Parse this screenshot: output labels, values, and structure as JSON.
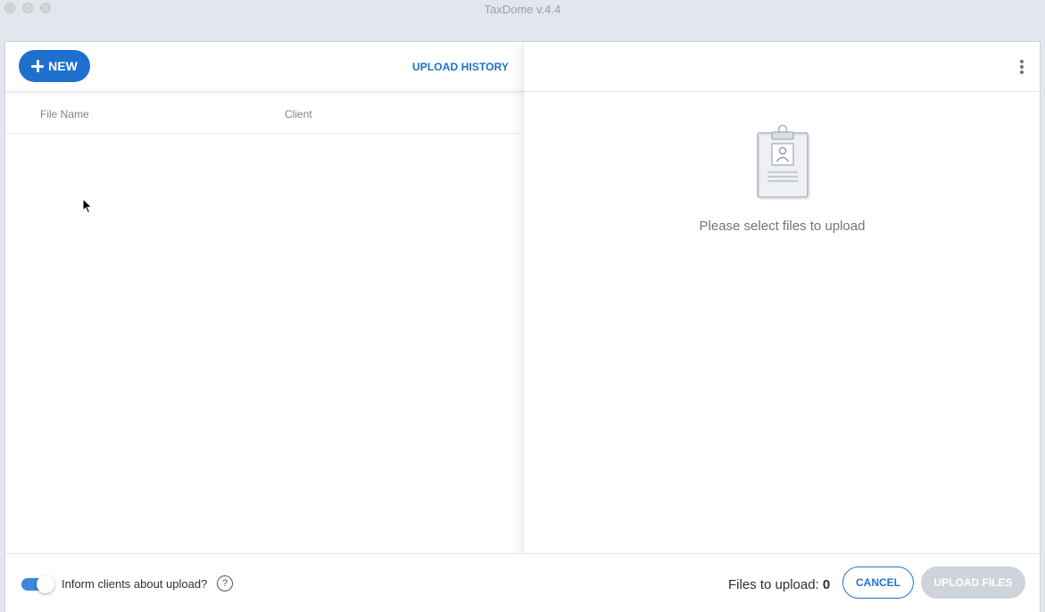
{
  "window": {
    "title": "TaxDome v.4.4"
  },
  "toolbar": {
    "new_label": "NEW",
    "upload_history_label": "UPLOAD HISTORY"
  },
  "table": {
    "columns": [
      "File Name",
      "Client"
    ],
    "rows": []
  },
  "preview": {
    "empty_message": "Please select files to upload"
  },
  "footer": {
    "inform_label": "Inform clients about upload?",
    "inform_enabled": true,
    "help_symbol": "?",
    "files_to_upload_label": "Files to upload:",
    "files_to_upload_count": "0",
    "cancel_label": "CANCEL",
    "upload_label": "UPLOAD FILES"
  },
  "colors": {
    "accent": "#1f6fcf",
    "disabled": "#cfd3da",
    "background": "#e3e6ec"
  },
  "icons": [
    "plus-icon",
    "more-vertical-icon",
    "clipboard-icon",
    "help-icon",
    "mouse-cursor-icon"
  ]
}
